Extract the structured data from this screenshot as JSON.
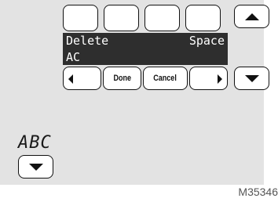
{
  "top_row": {
    "blank_keys": [
      "",
      "",
      "",
      ""
    ],
    "up_icon": "triangle-up"
  },
  "line1": {
    "delete_label": "Delete",
    "space_label": "Space"
  },
  "line2": {
    "entered_text": "AC"
  },
  "nav_row": {
    "left_icon": "triangle-left",
    "done_label": "Done",
    "cancel_label": "Cancel",
    "right_icon": "triangle-right",
    "down_icon": "triangle-down"
  },
  "mode": {
    "label": "ABC",
    "down_icon": "triangle-down"
  },
  "figure_code": "M35346",
  "colors": {
    "screen": "#e3e3e3",
    "bar": "#2e2e2e",
    "key_border": "#111111"
  }
}
